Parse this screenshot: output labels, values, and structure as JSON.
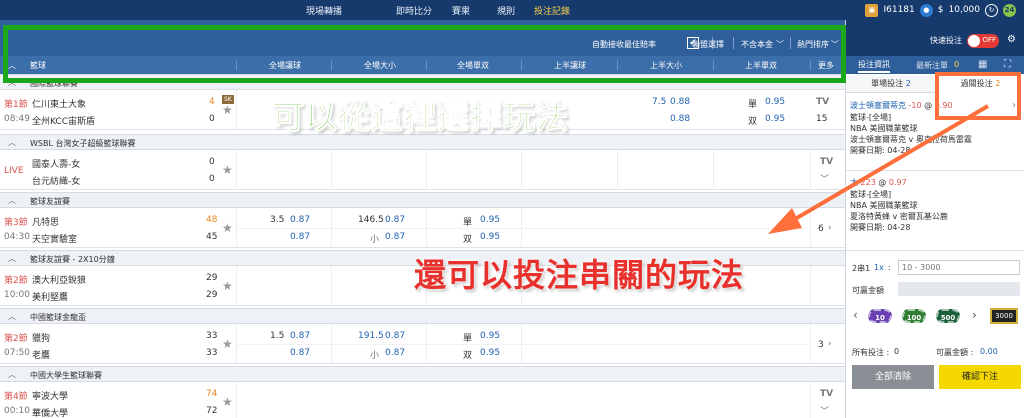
{
  "topnav": {
    "items": [
      "現場轉播",
      "即時比分",
      "賽果",
      "規則",
      "投注記錄"
    ],
    "active_index": 4
  },
  "account": {
    "user_id": "I61181",
    "currency": "$",
    "balance": "10,000",
    "badge_count": "24"
  },
  "filterbar": {
    "auto_accept_label": "自動接收最佳賠率",
    "auto_accept_checked": "✔",
    "league_select": "聯盟選擇",
    "currency_filter": "不含本金",
    "sort_filter": "熱門排序"
  },
  "table_header": {
    "sport": "籃球",
    "columns": [
      "全場讓球",
      "全場大小",
      "全場單双",
      "上半讓球",
      "上半大小",
      "上半單双",
      "更多"
    ]
  },
  "leagues": [
    {
      "name": "國際籃球聯賽",
      "match": {
        "period": "第1節",
        "time": "08:49",
        "home": "仁川東土大象",
        "away": "全州KCC宙斯盾",
        "home_score": "4",
        "away_score": "0",
        "badge": "SK",
        "hh_hcap": "7.5",
        "hh_odds": "0.88",
        "hh_odds2": "0.88",
        "hoe_label1": "單",
        "hoe_odds1": "0.95",
        "hoe_label2": "双",
        "hoe_odds2": "0.95",
        "tv": "TV",
        "more": "15"
      }
    },
    {
      "name": "WSBL 台灣女子超級籃球聯賽",
      "match": {
        "period": "LIVE",
        "time": "",
        "home": "國泰人壽-女",
        "away": "台元紡織-女",
        "home_score": "0",
        "away_score": "0",
        "tv": "TV",
        "more": ""
      }
    },
    {
      "name": "籃球友誼賽",
      "match": {
        "period": "第3節",
        "time": "04:30",
        "home": "凡特思",
        "away": "天空實驗室",
        "home_score": "48",
        "away_score": "45",
        "ft_hcap": "3.5",
        "ft_odds1": "0.87",
        "ft_odds2": "0.87",
        "ou_line": "146.5",
        "ou_odds1": "0.87",
        "ou_label2": "小",
        "ou_odds2": "0.87",
        "oe_label1": "單",
        "oe_odds1": "0.95",
        "oe_label2": "双",
        "oe_odds2": "0.95",
        "more": "6"
      }
    },
    {
      "name": "籃球友誼賽 - 2X10分鐘",
      "match": {
        "period": "第2節",
        "time": "10:00",
        "home": "澳大利亞銳狼",
        "away": "美利堅鷹",
        "home_score": "29",
        "away_score": "29"
      }
    },
    {
      "name": "中國籃球金龍盃",
      "match": {
        "period": "第2節",
        "time": "07:50",
        "home": "獵狗",
        "away": "老鷹",
        "home_score": "33",
        "away_score": "33",
        "ft_hcap": "1.5",
        "ft_odds1": "0.87",
        "ft_odds2": "0.87",
        "ou_line": "191.5",
        "ou_odds1": "0.87",
        "ou_label2": "小",
        "ou_odds2": "0.87",
        "oe_label1": "單",
        "oe_odds1": "0.95",
        "oe_label2": "双",
        "oe_odds2": "0.95",
        "more": "3"
      }
    },
    {
      "name": "中國大學生籃球聯賽",
      "match": {
        "period": "第4節",
        "time": "00:10",
        "home": "寧波大學",
        "away": "華僑大學",
        "home_score": "74",
        "away_score": "72",
        "tv": "TV"
      }
    }
  ],
  "rightpanel": {
    "quick_bet": "快速投注",
    "toggle_label": "OFF",
    "tab_bet_info": "投注資訊",
    "tab_recent": "最新注單",
    "tab_recent_count": "0",
    "subtab_single": "單場投注",
    "subtab_single_count": "2",
    "subtab_parlay": "過關投注",
    "subtab_parlay_count": "2",
    "bet1": {
      "title": "波士頓塞爾蒂克",
      "line": "-10",
      "at": "@",
      "odds": "0.90",
      "lines": [
        "籃球-[全場]",
        "NBA 美國職業籃球",
        "波士頓塞爾蒂克 v 奧克拉荷馬雷霆",
        "開賽日期: 04-28"
      ]
    },
    "bet2": {
      "title": "大",
      "line": "223",
      "at": "@",
      "odds": "0.97",
      "lines": [
        "籃球-[全場]",
        "NBA 美國職業籃球",
        "夏洛特黃蜂 v 密爾瓦基公鹿",
        "開賽日期: 04-28"
      ]
    },
    "parlay_label": "2串1",
    "parlay_multiplier": "1x",
    "parlay_colon": ":",
    "stake_placeholder": "10 - 3000",
    "winnable_label": "可贏金額",
    "chips": [
      "10",
      "100",
      "500",
      "3000"
    ],
    "all_stake_label": "所有投注 : ",
    "all_stake_value": "0",
    "win_label": "可贏金額 : ",
    "win_value": "0.00",
    "clear_all": "全部清除",
    "confirm": "確認下注"
  },
  "annotations": {
    "green_text": "可以從這裡選擇玩法",
    "red_text": "還可以投注串關的玩法"
  }
}
